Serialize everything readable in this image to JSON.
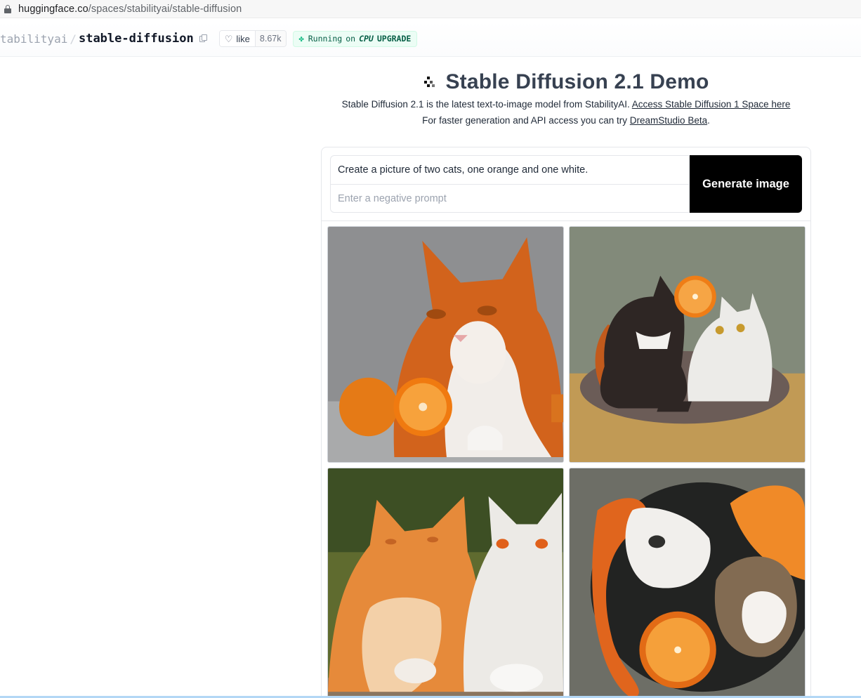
{
  "browser": {
    "url_host": "huggingface.co",
    "url_path": "/spaces/stabilityai/stable-diffusion"
  },
  "header": {
    "org": "tabilityai",
    "slash": "/",
    "repo": "stable-diffusion",
    "like_label": "like",
    "like_count": "8.67k",
    "status": "Running",
    "status_on": "on",
    "hardware": "CPU",
    "upgrade": "UPGRADE"
  },
  "main": {
    "title": "Stable Diffusion 2.1 Demo",
    "subtitle1_text": "Stable Diffusion 2.1 is the latest text-to-image model from StabilityAI. ",
    "subtitle1_link": "Access Stable Diffusion 1 Space here",
    "subtitle2_text": "For faster generation and API access you can try ",
    "subtitle2_link": "DreamStudio Beta",
    "subtitle2_end": "."
  },
  "form": {
    "prompt_value": "Create a picture of two cats, one orange and one white.",
    "negative_placeholder": "Enter a negative prompt",
    "generate_label": "Generate image"
  },
  "gallery": {
    "images": [
      {
        "id": "gallery-image-1"
      },
      {
        "id": "gallery-image-2"
      },
      {
        "id": "gallery-image-3"
      },
      {
        "id": "gallery-image-4"
      }
    ]
  },
  "colors": {
    "accent_status": "#10b981",
    "button_bg": "#000000"
  }
}
